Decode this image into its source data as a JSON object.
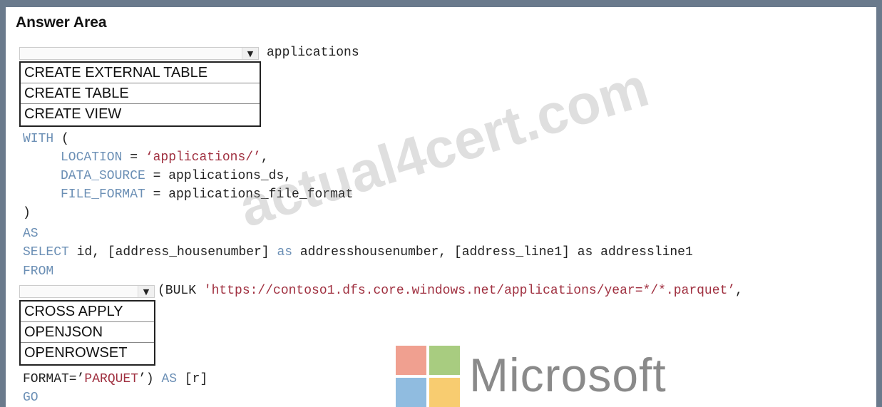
{
  "title": "Answer Area",
  "dropdown1": {
    "suffix": "applications",
    "options": [
      "CREATE EXTERNAL TABLE",
      "CREATE TABLE",
      "CREATE VIEW"
    ]
  },
  "code": {
    "with_kw": "WITH",
    "with_paren": " (",
    "location_key": "LOCATION",
    "location_eq": " = ",
    "location_val": "‘applications/’",
    "location_comma": ",",
    "datasource_key": "DATA_SOURCE",
    "datasource_rest": " = applications_ds,",
    "fileformat_key": "FILE_FORMAT",
    "fileformat_rest": " = applications_file_format",
    "close_paren": ")",
    "as_kw": "AS",
    "select_kw": "SELECT",
    "select_part1": " id, [address_housenumber] ",
    "as_lower": "as",
    "select_part2": " addresshousenumber, [address_line1] as addressline1",
    "from_kw": "FROM",
    "bulk_prefix": "(BULK ",
    "bulk_url": "'https://contoso1.dfs.core.windows.net/applications/year=*/*.parquet’",
    "bulk_comma": ",",
    "format_prefix": "FORMAT=’",
    "format_val": "PARQUET",
    "format_suffix_close": "’) ",
    "format_as": "AS",
    "format_alias": " [r]",
    "go_kw": "GO"
  },
  "dropdown2": {
    "options": [
      "CROSS APPLY",
      "OPENJSON",
      "OPENROWSET"
    ]
  },
  "watermark": "actual4cert.com",
  "logo": {
    "text": "Microsoft",
    "colors": [
      "#f0a090",
      "#a8cc80",
      "#90bce0",
      "#f8cc70"
    ]
  }
}
